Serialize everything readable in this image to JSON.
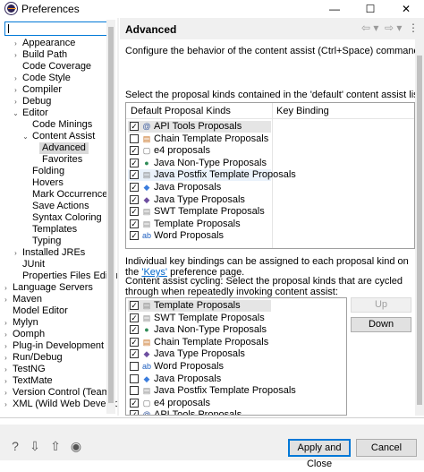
{
  "window": {
    "title": "Preferences",
    "minimize": "—",
    "maximize": "☐",
    "close": "✕"
  },
  "filter": {
    "value": ""
  },
  "tree": [
    {
      "label": "Appearance",
      "indent": 1,
      "twisty": "›"
    },
    {
      "label": "Build Path",
      "indent": 1,
      "twisty": "›"
    },
    {
      "label": "Code Coverage",
      "indent": 1,
      "twisty": ""
    },
    {
      "label": "Code Style",
      "indent": 1,
      "twisty": "›"
    },
    {
      "label": "Compiler",
      "indent": 1,
      "twisty": "›"
    },
    {
      "label": "Debug",
      "indent": 1,
      "twisty": "›"
    },
    {
      "label": "Editor",
      "indent": 1,
      "twisty": "⌄"
    },
    {
      "label": "Code Minings",
      "indent": 2,
      "twisty": ""
    },
    {
      "label": "Content Assist",
      "indent": 2,
      "twisty": "⌄"
    },
    {
      "label": "Advanced",
      "indent": 3,
      "twisty": "",
      "selected": true
    },
    {
      "label": "Favorites",
      "indent": 3,
      "twisty": ""
    },
    {
      "label": "Folding",
      "indent": 2,
      "twisty": ""
    },
    {
      "label": "Hovers",
      "indent": 2,
      "twisty": ""
    },
    {
      "label": "Mark Occurrences",
      "indent": 2,
      "twisty": ""
    },
    {
      "label": "Save Actions",
      "indent": 2,
      "twisty": ""
    },
    {
      "label": "Syntax Coloring",
      "indent": 2,
      "twisty": ""
    },
    {
      "label": "Templates",
      "indent": 2,
      "twisty": ""
    },
    {
      "label": "Typing",
      "indent": 2,
      "twisty": ""
    },
    {
      "label": "Installed JREs",
      "indent": 1,
      "twisty": "›"
    },
    {
      "label": "JUnit",
      "indent": 1,
      "twisty": ""
    },
    {
      "label": "Properties Files Editor",
      "indent": 1,
      "twisty": ""
    },
    {
      "label": "Language Servers",
      "indent": 0,
      "twisty": "›"
    },
    {
      "label": "Maven",
      "indent": 0,
      "twisty": "›"
    },
    {
      "label": "Model Editor",
      "indent": 0,
      "twisty": ""
    },
    {
      "label": "Mylyn",
      "indent": 0,
      "twisty": "›"
    },
    {
      "label": "Oomph",
      "indent": 0,
      "twisty": "›"
    },
    {
      "label": "Plug-in Development",
      "indent": 0,
      "twisty": "›"
    },
    {
      "label": "Run/Debug",
      "indent": 0,
      "twisty": "›"
    },
    {
      "label": "TestNG",
      "indent": 0,
      "twisty": "›"
    },
    {
      "label": "TextMate",
      "indent": 0,
      "twisty": "›"
    },
    {
      "label": "Version Control (Team)",
      "indent": 0,
      "twisty": "›"
    },
    {
      "label": "XML (Wild Web Developer)",
      "indent": 0,
      "twisty": "›"
    }
  ],
  "page": {
    "title": "Advanced",
    "description": "Configure the behavior of the content assist (Ctrl+Space) command.",
    "default_list_label": "Select the proposal kinds contained in the 'default' content assist list:",
    "col_kinds": "Default Proposal Kinds",
    "col_binding": "Key Binding",
    "binding_text_before": "Individual key bindings can be assigned to each proposal kind on the ",
    "binding_link": "'Keys'",
    "binding_text_after": " preference page.",
    "cycling_label": "Content assist cycling: Select the proposal kinds that are cycled through when repeatedly invoking content assist:",
    "up": "Up",
    "down": "Down"
  },
  "default_kinds": [
    {
      "label": "API Tools Proposals",
      "checked": true,
      "icon": "@",
      "icon_color": "#3a5ba0",
      "state": "sel"
    },
    {
      "label": "Chain Template Proposals",
      "checked": false,
      "icon": "▤",
      "icon_color": "#c66c1a"
    },
    {
      "label": "e4 proposals",
      "checked": true,
      "icon": "▢",
      "icon_color": "#6a6a6a"
    },
    {
      "label": "Java Non-Type Proposals",
      "checked": true,
      "icon": "●",
      "icon_color": "#2e8b57"
    },
    {
      "label": "Java Postfix Template Proposals",
      "checked": true,
      "icon": "▤",
      "icon_color": "#888888",
      "state": "hl"
    },
    {
      "label": "Java Proposals",
      "checked": true,
      "icon": "◆",
      "icon_color": "#3b7ddd"
    },
    {
      "label": "Java Type Proposals",
      "checked": true,
      "icon": "◆",
      "icon_color": "#6d4ea0"
    },
    {
      "label": "SWT Template Proposals",
      "checked": true,
      "icon": "▤",
      "icon_color": "#888888"
    },
    {
      "label": "Template Proposals",
      "checked": true,
      "icon": "▤",
      "icon_color": "#888888"
    },
    {
      "label": "Word Proposals",
      "checked": true,
      "icon": "ab",
      "icon_color": "#1f5fbf"
    }
  ],
  "cycling_kinds": [
    {
      "label": "Template Proposals",
      "checked": true,
      "icon": "▤",
      "icon_color": "#888888",
      "state": "sel"
    },
    {
      "label": "SWT Template Proposals",
      "checked": true,
      "icon": "▤",
      "icon_color": "#888888"
    },
    {
      "label": "Java Non-Type Proposals",
      "checked": true,
      "icon": "●",
      "icon_color": "#2e8b57"
    },
    {
      "label": "Chain Template Proposals",
      "checked": true,
      "icon": "▤",
      "icon_color": "#c66c1a"
    },
    {
      "label": "Java Type Proposals",
      "checked": true,
      "icon": "◆",
      "icon_color": "#6d4ea0"
    },
    {
      "label": "Word Proposals",
      "checked": false,
      "icon": "ab",
      "icon_color": "#1f5fbf"
    },
    {
      "label": "Java Proposals",
      "checked": false,
      "icon": "◆",
      "icon_color": "#3b7ddd"
    },
    {
      "label": "Java Postfix Template Proposals",
      "checked": false,
      "icon": "▤",
      "icon_color": "#888888"
    },
    {
      "label": "e4 proposals",
      "checked": true,
      "icon": "▢",
      "icon_color": "#6a6a6a"
    },
    {
      "label": "API Tools Proposals",
      "checked": true,
      "icon": "@",
      "icon_color": "#3a5ba0"
    }
  ],
  "footer": {
    "apply_close": "Apply and Close",
    "cancel": "Cancel"
  }
}
